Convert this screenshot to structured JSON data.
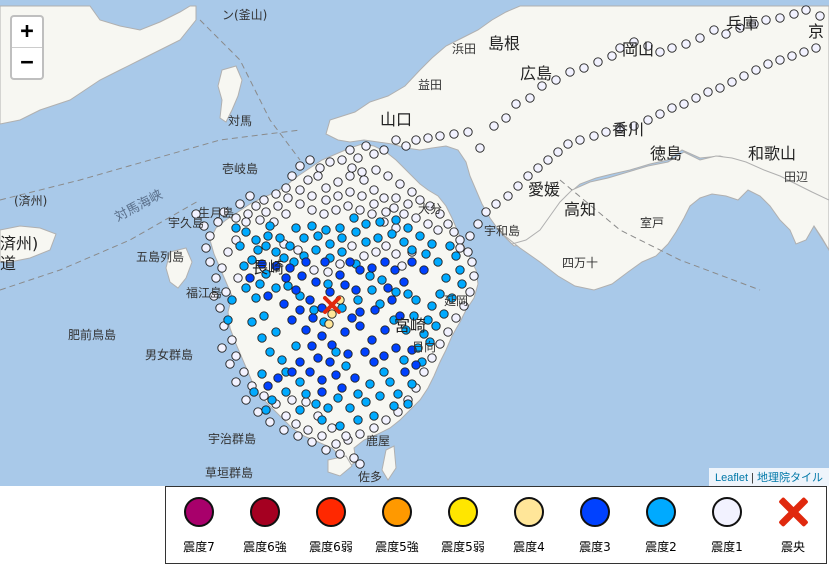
{
  "map": {
    "zoom_in": "+",
    "zoom_out": "−",
    "attribution": {
      "leaflet": "Leaflet",
      "separator": "|",
      "tiles": "地理院タイル"
    },
    "labels": {
      "shimane": "島根",
      "hiroshima": "広島",
      "okayama": "岡山",
      "hyogo": "兵庫",
      "kyoto": "京",
      "yamaguchi": "山口",
      "kagawa": "香川",
      "tokushima": "徳島",
      "wakayama": "和歌山",
      "ehime": "愛媛",
      "kochi": "高知",
      "nagasaki": "長崎",
      "miyazaki": "宮崎",
      "tsushima": "対馬",
      "goto": "五島列島",
      "danjo": "男女群島",
      "uji": "宇治群島",
      "kusagaki": "草垣群島",
      "tsushima_strait": "対馬海峡",
      "hizen": "肥前鳥島",
      "fukue": "福江島",
      "hamada": "浜田",
      "masuda": "益田",
      "oita": "大分",
      "nobeoka": "延岡",
      "hyuga": "日向",
      "kanoya": "鹿屋",
      "sata": "佐多",
      "uwajima": "宇和島",
      "shimanto": "四万十",
      "muroto": "室戸",
      "tanabe": "田辺",
      "kyosai": "(済州)",
      "zhou": "済州)",
      "dao": "道",
      "kanazan": "ン(釜山)",
      "iki": "壱岐島",
      "ikitsuki": "生月島",
      "ojika": "宇久島"
    }
  },
  "legend": [
    {
      "label": "震度7",
      "color": "#a8006b"
    },
    {
      "label": "震度6強",
      "color": "#a50021"
    },
    {
      "label": "震度6弱",
      "color": "#ff2800"
    },
    {
      "label": "震度5強",
      "color": "#ff9900"
    },
    {
      "label": "震度5弱",
      "color": "#ffe600"
    },
    {
      "label": "震度4",
      "color": "#ffe699"
    },
    {
      "label": "震度3",
      "color": "#0041ff"
    },
    {
      "label": "震度2",
      "color": "#00aaff"
    },
    {
      "label": "震度1",
      "color": "#f2f2ff"
    },
    {
      "label": "震央",
      "color": "#e0290e"
    }
  ],
  "colors": {
    "sea": "#a9c9e9",
    "land": "#f7f7f2",
    "int1": "#f2f2ff",
    "int2": "#00aaff",
    "int3": "#0041ff",
    "int4": "#ffe699",
    "epicenter": "#e0290e"
  },
  "stations": {
    "int4": [
      [
        332,
        314
      ],
      [
        329,
        324
      ],
      [
        340,
        300
      ]
    ],
    "int3": [
      [
        290,
        268
      ],
      [
        302,
        276
      ],
      [
        296,
        290
      ],
      [
        310,
        300
      ],
      [
        300,
        310
      ],
      [
        313,
        318
      ],
      [
        322,
        308
      ],
      [
        330,
        292
      ],
      [
        345,
        285
      ],
      [
        356,
        290
      ],
      [
        340,
        275
      ],
      [
        325,
        262
      ],
      [
        350,
        262
      ],
      [
        360,
        270
      ],
      [
        372,
        268
      ],
      [
        385,
        262
      ],
      [
        316,
        282
      ],
      [
        306,
        262
      ],
      [
        286,
        278
      ],
      [
        276,
        266
      ],
      [
        262,
        264
      ],
      [
        250,
        278
      ],
      [
        268,
        296
      ],
      [
        284,
        304
      ],
      [
        292,
        320
      ],
      [
        306,
        330
      ],
      [
        322,
        336
      ],
      [
        332,
        345
      ],
      [
        345,
        332
      ],
      [
        360,
        326
      ],
      [
        372,
        340
      ],
      [
        385,
        330
      ],
      [
        375,
        310
      ],
      [
        360,
        312
      ],
      [
        352,
        318
      ],
      [
        312,
        346
      ],
      [
        318,
        358
      ],
      [
        330,
        362
      ],
      [
        336,
        375
      ],
      [
        322,
        380
      ],
      [
        310,
        372
      ],
      [
        300,
        362
      ],
      [
        292,
        372
      ],
      [
        278,
        378
      ],
      [
        268,
        386
      ],
      [
        322,
        392
      ],
      [
        342,
        388
      ],
      [
        355,
        378
      ],
      [
        365,
        352
      ],
      [
        348,
        354
      ],
      [
        388,
        288
      ],
      [
        395,
        270
      ],
      [
        404,
        282
      ],
      [
        412,
        262
      ],
      [
        424,
        270
      ],
      [
        392,
        300
      ],
      [
        400,
        316
      ],
      [
        412,
        350
      ],
      [
        405,
        372
      ],
      [
        416,
        365
      ],
      [
        396,
        348
      ],
      [
        384,
        356
      ],
      [
        374,
        362
      ]
    ],
    "int2": [
      [
        236,
        228
      ],
      [
        256,
        240
      ],
      [
        266,
        246
      ],
      [
        276,
        252
      ],
      [
        290,
        246
      ],
      [
        304,
        238
      ],
      [
        318,
        236
      ],
      [
        330,
        244
      ],
      [
        342,
        238
      ],
      [
        356,
        232
      ],
      [
        366,
        242
      ],
      [
        378,
        238
      ],
      [
        392,
        234
      ],
      [
        404,
        242
      ],
      [
        412,
        250
      ],
      [
        426,
        254
      ],
      [
        438,
        262
      ],
      [
        446,
        278
      ],
      [
        440,
        294
      ],
      [
        432,
        306
      ],
      [
        428,
        320
      ],
      [
        424,
        334
      ],
      [
        418,
        348
      ],
      [
        404,
        360
      ],
      [
        390,
        382
      ],
      [
        380,
        396
      ],
      [
        366,
        402
      ],
      [
        350,
        408
      ],
      [
        338,
        398
      ],
      [
        328,
        408
      ],
      [
        316,
        404
      ],
      [
        306,
        394
      ],
      [
        300,
        382
      ],
      [
        286,
        392
      ],
      [
        272,
        400
      ],
      [
        282,
        360
      ],
      [
        296,
        346
      ],
      [
        276,
        332
      ],
      [
        264,
        316
      ],
      [
        256,
        298
      ],
      [
        246,
        288
      ],
      [
        260,
        284
      ],
      [
        252,
        260
      ],
      [
        240,
        246
      ],
      [
        246,
        232
      ],
      [
        270,
        226
      ],
      [
        296,
        228
      ],
      [
        312,
        226
      ],
      [
        326,
        230
      ],
      [
        340,
        228
      ],
      [
        354,
        218
      ],
      [
        366,
        224
      ],
      [
        380,
        222
      ],
      [
        396,
        220
      ],
      [
        408,
        228
      ],
      [
        420,
        236
      ],
      [
        432,
        244
      ],
      [
        450,
        246
      ],
      [
        456,
        256
      ],
      [
        460,
        270
      ],
      [
        462,
        284
      ],
      [
        452,
        298
      ],
      [
        444,
        314
      ],
      [
        436,
        326
      ],
      [
        430,
        342
      ],
      [
        422,
        362
      ],
      [
        412,
        384
      ],
      [
        398,
        394
      ],
      [
        384,
        372
      ],
      [
        370,
        384
      ],
      [
        358,
        394
      ],
      [
        346,
        366
      ],
      [
        336,
        352
      ],
      [
        324,
        322
      ],
      [
        314,
        310
      ],
      [
        300,
        296
      ],
      [
        288,
        286
      ],
      [
        276,
        288
      ],
      [
        266,
        274
      ],
      [
        328,
        284
      ],
      [
        342,
        308
      ],
      [
        358,
        300
      ],
      [
        372,
        290
      ],
      [
        380,
        304
      ],
      [
        394,
        320
      ],
      [
        406,
        330
      ],
      [
        414,
        316
      ],
      [
        416,
        300
      ],
      [
        408,
        294
      ],
      [
        396,
        292
      ],
      [
        382,
        280
      ],
      [
        370,
        276
      ],
      [
        356,
        264
      ],
      [
        342,
        252
      ],
      [
        330,
        258
      ],
      [
        316,
        250
      ],
      [
        304,
        256
      ],
      [
        294,
        262
      ],
      [
        284,
        258
      ],
      [
        280,
        238
      ],
      [
        268,
        236
      ],
      [
        258,
        250
      ],
      [
        244,
        266
      ],
      [
        232,
        300
      ],
      [
        228,
        320
      ],
      [
        252,
        322
      ],
      [
        262,
        338
      ],
      [
        270,
        352
      ],
      [
        286,
        372
      ],
      [
        262,
        374
      ],
      [
        254,
        392
      ],
      [
        266,
        410
      ],
      [
        300,
        410
      ],
      [
        322,
        420
      ],
      [
        340,
        426
      ],
      [
        358,
        420
      ],
      [
        374,
        416
      ],
      [
        394,
        406
      ],
      [
        408,
        404
      ]
    ],
    "int1": [
      [
        218,
        222
      ],
      [
        224,
        212
      ],
      [
        240,
        204
      ],
      [
        250,
        196
      ],
      [
        264,
        200
      ],
      [
        278,
        206
      ],
      [
        288,
        198
      ],
      [
        300,
        190
      ],
      [
        312,
        196
      ],
      [
        326,
        188
      ],
      [
        338,
        182
      ],
      [
        350,
        176
      ],
      [
        362,
        172
      ],
      [
        376,
        170
      ],
      [
        388,
        176
      ],
      [
        400,
        184
      ],
      [
        412,
        192
      ],
      [
        420,
        200
      ],
      [
        430,
        206
      ],
      [
        440,
        214
      ],
      [
        448,
        224
      ],
      [
        454,
        232
      ],
      [
        460,
        240
      ],
      [
        468,
        252
      ],
      [
        472,
        262
      ],
      [
        474,
        276
      ],
      [
        470,
        292
      ],
      [
        464,
        306
      ],
      [
        456,
        318
      ],
      [
        448,
        332
      ],
      [
        440,
        344
      ],
      [
        432,
        358
      ],
      [
        424,
        372
      ],
      [
        416,
        388
      ],
      [
        408,
        400
      ],
      [
        398,
        412
      ],
      [
        386,
        420
      ],
      [
        374,
        428
      ],
      [
        360,
        434
      ],
      [
        348,
        440
      ],
      [
        336,
        444
      ],
      [
        322,
        436
      ],
      [
        308,
        430
      ],
      [
        296,
        424
      ],
      [
        286,
        416
      ],
      [
        276,
        404
      ],
      [
        264,
        396
      ],
      [
        252,
        386
      ],
      [
        244,
        372
      ],
      [
        236,
        356
      ],
      [
        232,
        340
      ],
      [
        224,
        326
      ],
      [
        220,
        308
      ],
      [
        226,
        292
      ],
      [
        216,
        278
      ],
      [
        210,
        262
      ],
      [
        206,
        248
      ],
      [
        210,
        236
      ],
      [
        204,
        226
      ],
      [
        196,
        214
      ],
      [
        350,
        150
      ],
      [
        358,
        158
      ],
      [
        366,
        146
      ],
      [
        374,
        154
      ],
      [
        384,
        150
      ],
      [
        396,
        140
      ],
      [
        406,
        146
      ],
      [
        416,
        140
      ],
      [
        428,
        138
      ],
      [
        440,
        136
      ],
      [
        454,
        134
      ],
      [
        468,
        132
      ],
      [
        480,
        148
      ],
      [
        494,
        126
      ],
      [
        506,
        118
      ],
      [
        516,
        104
      ],
      [
        530,
        98
      ],
      [
        542,
        86
      ],
      [
        556,
        80
      ],
      [
        570,
        72
      ],
      [
        584,
        68
      ],
      [
        598,
        62
      ],
      [
        612,
        56
      ],
      [
        620,
        48
      ],
      [
        634,
        42
      ],
      [
        648,
        46
      ],
      [
        660,
        52
      ],
      [
        672,
        48
      ],
      [
        686,
        44
      ],
      [
        700,
        38
      ],
      [
        714,
        30
      ],
      [
        726,
        34
      ],
      [
        740,
        28
      ],
      [
        754,
        24
      ],
      [
        766,
        20
      ],
      [
        780,
        18
      ],
      [
        794,
        14
      ],
      [
        806,
        10
      ],
      [
        820,
        16
      ],
      [
        292,
        176
      ],
      [
        300,
        166
      ],
      [
        310,
        160
      ],
      [
        320,
        168
      ],
      [
        330,
        162
      ],
      [
        342,
        160
      ],
      [
        352,
        168
      ],
      [
        364,
        180
      ],
      [
        374,
        190
      ],
      [
        384,
        198
      ],
      [
        394,
        208
      ],
      [
        404,
        214
      ],
      [
        416,
        218
      ],
      [
        428,
        224
      ],
      [
        438,
        230
      ],
      [
        326,
        200
      ],
      [
        338,
        196
      ],
      [
        350,
        192
      ],
      [
        362,
        196
      ],
      [
        374,
        204
      ],
      [
        386,
        212
      ],
      [
        396,
        198
      ],
      [
        408,
        204
      ],
      [
        300,
        204
      ],
      [
        312,
        210
      ],
      [
        324,
        214
      ],
      [
        336,
        210
      ],
      [
        348,
        206
      ],
      [
        360,
        210
      ],
      [
        372,
        214
      ],
      [
        384,
        222
      ],
      [
        396,
        228
      ],
      [
        286,
        214
      ],
      [
        274,
        222
      ],
      [
        260,
        220
      ],
      [
        248,
        214
      ],
      [
        236,
        218
      ],
      [
        308,
        180
      ],
      [
        318,
        176
      ],
      [
        286,
        188
      ],
      [
        276,
        194
      ],
      [
        266,
        212
      ],
      [
        256,
        206
      ],
      [
        246,
        222
      ],
      [
        236,
        240
      ],
      [
        228,
        252
      ],
      [
        222,
        268
      ],
      [
        238,
        278
      ],
      [
        214,
        296
      ],
      [
        222,
        348
      ],
      [
        230,
        364
      ],
      [
        236,
        382
      ],
      [
        246,
        400
      ],
      [
        258,
        412
      ],
      [
        270,
        422
      ],
      [
        284,
        430
      ],
      [
        298,
        436
      ],
      [
        312,
        442
      ],
      [
        326,
        450
      ],
      [
        340,
        454
      ],
      [
        354,
        458
      ],
      [
        360,
        464
      ],
      [
        346,
        436
      ],
      [
        332,
        428
      ],
      [
        318,
        416
      ],
      [
        306,
        402
      ],
      [
        292,
        400
      ],
      [
        460,
        248
      ],
      [
        470,
        236
      ],
      [
        478,
        224
      ],
      [
        486,
        212
      ],
      [
        496,
        204
      ],
      [
        508,
        196
      ],
      [
        518,
        186
      ],
      [
        528,
        176
      ],
      [
        538,
        168
      ],
      [
        548,
        160
      ],
      [
        558,
        152
      ],
      [
        568,
        144
      ],
      [
        580,
        140
      ],
      [
        594,
        136
      ],
      [
        606,
        132
      ],
      [
        620,
        128
      ],
      [
        634,
        126
      ],
      [
        648,
        120
      ],
      [
        660,
        114
      ],
      [
        672,
        108
      ],
      [
        684,
        104
      ],
      [
        696,
        98
      ],
      [
        708,
        92
      ],
      [
        720,
        88
      ],
      [
        732,
        82
      ],
      [
        744,
        76
      ],
      [
        756,
        70
      ],
      [
        768,
        64
      ],
      [
        780,
        60
      ],
      [
        792,
        56
      ],
      [
        804,
        52
      ],
      [
        816,
        48
      ],
      [
        412,
        252
      ],
      [
        402,
        266
      ],
      [
        396,
        254
      ],
      [
        386,
        246
      ],
      [
        376,
        252
      ],
      [
        364,
        256
      ],
      [
        352,
        246
      ],
      [
        340,
        264
      ],
      [
        328,
        272
      ],
      [
        314,
        270
      ],
      [
        298,
        250
      ],
      [
        284,
        244
      ]
    ]
  },
  "epicenter": [
    332,
    305
  ]
}
